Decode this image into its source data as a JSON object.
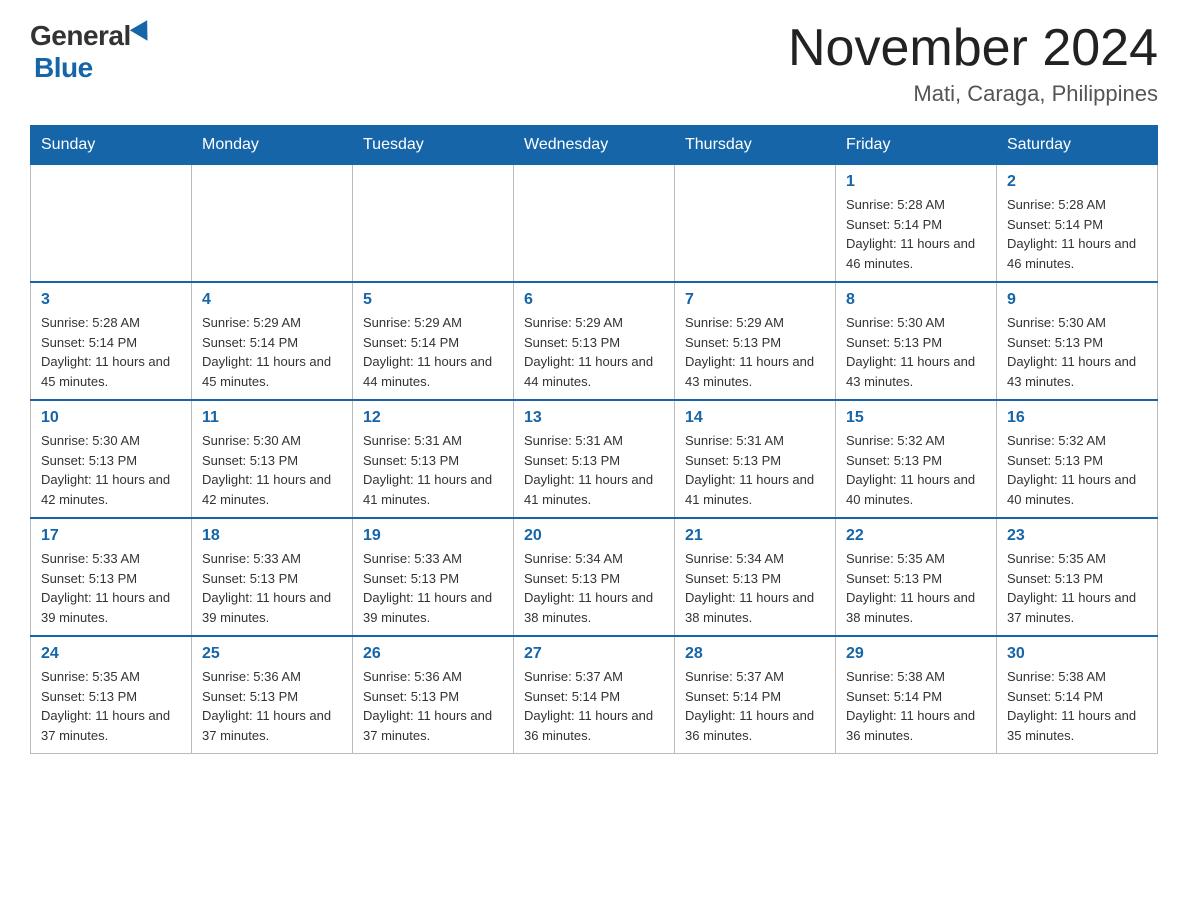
{
  "header": {
    "logo_general": "General",
    "logo_blue": "Blue",
    "month_title": "November 2024",
    "location": "Mati, Caraga, Philippines"
  },
  "days_of_week": [
    "Sunday",
    "Monday",
    "Tuesday",
    "Wednesday",
    "Thursday",
    "Friday",
    "Saturday"
  ],
  "weeks": [
    [
      {
        "day": "",
        "info": ""
      },
      {
        "day": "",
        "info": ""
      },
      {
        "day": "",
        "info": ""
      },
      {
        "day": "",
        "info": ""
      },
      {
        "day": "",
        "info": ""
      },
      {
        "day": "1",
        "info": "Sunrise: 5:28 AM\nSunset: 5:14 PM\nDaylight: 11 hours and 46 minutes."
      },
      {
        "day": "2",
        "info": "Sunrise: 5:28 AM\nSunset: 5:14 PM\nDaylight: 11 hours and 46 minutes."
      }
    ],
    [
      {
        "day": "3",
        "info": "Sunrise: 5:28 AM\nSunset: 5:14 PM\nDaylight: 11 hours and 45 minutes."
      },
      {
        "day": "4",
        "info": "Sunrise: 5:29 AM\nSunset: 5:14 PM\nDaylight: 11 hours and 45 minutes."
      },
      {
        "day": "5",
        "info": "Sunrise: 5:29 AM\nSunset: 5:14 PM\nDaylight: 11 hours and 44 minutes."
      },
      {
        "day": "6",
        "info": "Sunrise: 5:29 AM\nSunset: 5:13 PM\nDaylight: 11 hours and 44 minutes."
      },
      {
        "day": "7",
        "info": "Sunrise: 5:29 AM\nSunset: 5:13 PM\nDaylight: 11 hours and 43 minutes."
      },
      {
        "day": "8",
        "info": "Sunrise: 5:30 AM\nSunset: 5:13 PM\nDaylight: 11 hours and 43 minutes."
      },
      {
        "day": "9",
        "info": "Sunrise: 5:30 AM\nSunset: 5:13 PM\nDaylight: 11 hours and 43 minutes."
      }
    ],
    [
      {
        "day": "10",
        "info": "Sunrise: 5:30 AM\nSunset: 5:13 PM\nDaylight: 11 hours and 42 minutes."
      },
      {
        "day": "11",
        "info": "Sunrise: 5:30 AM\nSunset: 5:13 PM\nDaylight: 11 hours and 42 minutes."
      },
      {
        "day": "12",
        "info": "Sunrise: 5:31 AM\nSunset: 5:13 PM\nDaylight: 11 hours and 41 minutes."
      },
      {
        "day": "13",
        "info": "Sunrise: 5:31 AM\nSunset: 5:13 PM\nDaylight: 11 hours and 41 minutes."
      },
      {
        "day": "14",
        "info": "Sunrise: 5:31 AM\nSunset: 5:13 PM\nDaylight: 11 hours and 41 minutes."
      },
      {
        "day": "15",
        "info": "Sunrise: 5:32 AM\nSunset: 5:13 PM\nDaylight: 11 hours and 40 minutes."
      },
      {
        "day": "16",
        "info": "Sunrise: 5:32 AM\nSunset: 5:13 PM\nDaylight: 11 hours and 40 minutes."
      }
    ],
    [
      {
        "day": "17",
        "info": "Sunrise: 5:33 AM\nSunset: 5:13 PM\nDaylight: 11 hours and 39 minutes."
      },
      {
        "day": "18",
        "info": "Sunrise: 5:33 AM\nSunset: 5:13 PM\nDaylight: 11 hours and 39 minutes."
      },
      {
        "day": "19",
        "info": "Sunrise: 5:33 AM\nSunset: 5:13 PM\nDaylight: 11 hours and 39 minutes."
      },
      {
        "day": "20",
        "info": "Sunrise: 5:34 AM\nSunset: 5:13 PM\nDaylight: 11 hours and 38 minutes."
      },
      {
        "day": "21",
        "info": "Sunrise: 5:34 AM\nSunset: 5:13 PM\nDaylight: 11 hours and 38 minutes."
      },
      {
        "day": "22",
        "info": "Sunrise: 5:35 AM\nSunset: 5:13 PM\nDaylight: 11 hours and 38 minutes."
      },
      {
        "day": "23",
        "info": "Sunrise: 5:35 AM\nSunset: 5:13 PM\nDaylight: 11 hours and 37 minutes."
      }
    ],
    [
      {
        "day": "24",
        "info": "Sunrise: 5:35 AM\nSunset: 5:13 PM\nDaylight: 11 hours and 37 minutes."
      },
      {
        "day": "25",
        "info": "Sunrise: 5:36 AM\nSunset: 5:13 PM\nDaylight: 11 hours and 37 minutes."
      },
      {
        "day": "26",
        "info": "Sunrise: 5:36 AM\nSunset: 5:13 PM\nDaylight: 11 hours and 37 minutes."
      },
      {
        "day": "27",
        "info": "Sunrise: 5:37 AM\nSunset: 5:14 PM\nDaylight: 11 hours and 36 minutes."
      },
      {
        "day": "28",
        "info": "Sunrise: 5:37 AM\nSunset: 5:14 PM\nDaylight: 11 hours and 36 minutes."
      },
      {
        "day": "29",
        "info": "Sunrise: 5:38 AM\nSunset: 5:14 PM\nDaylight: 11 hours and 36 minutes."
      },
      {
        "day": "30",
        "info": "Sunrise: 5:38 AM\nSunset: 5:14 PM\nDaylight: 11 hours and 35 minutes."
      }
    ]
  ]
}
